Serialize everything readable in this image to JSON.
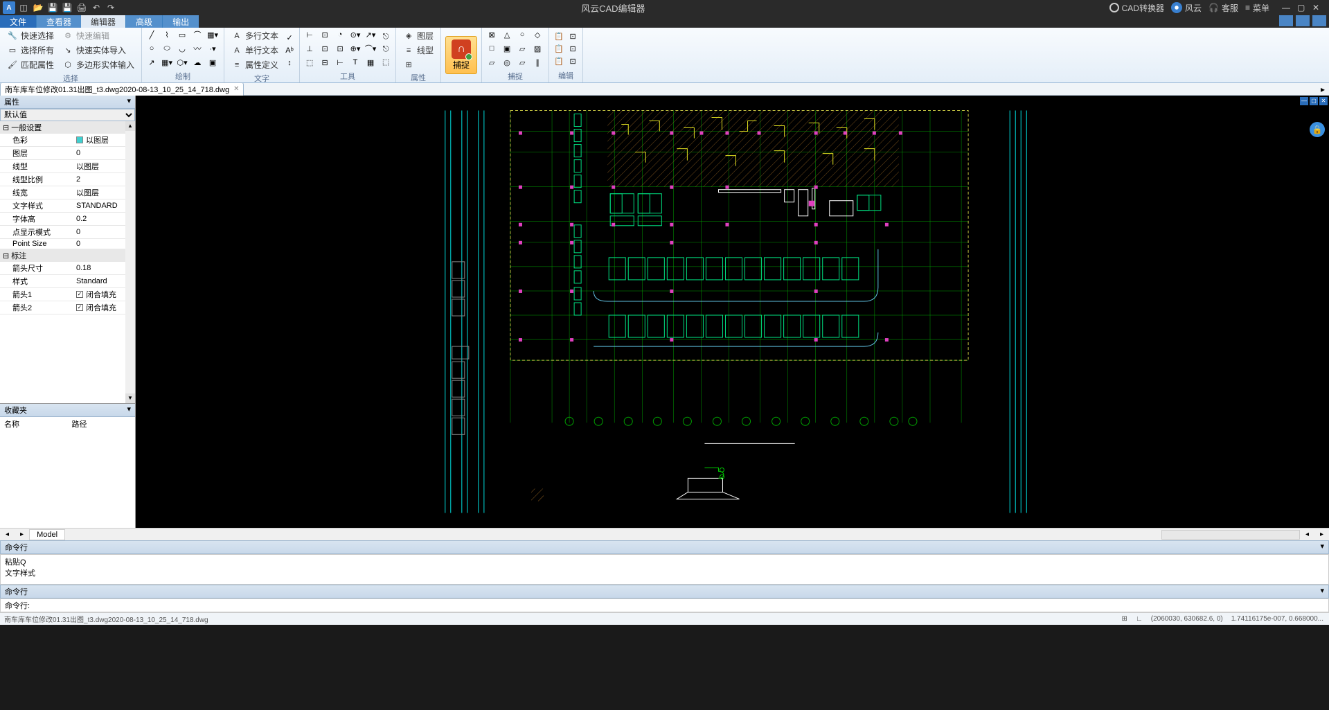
{
  "app_title": "风云CAD编辑器",
  "titlebar_right": {
    "converter": "CAD转换器",
    "fengyun": "风云",
    "support": "客服",
    "menu": "菜单"
  },
  "menubar": {
    "file": "文件",
    "view": "查看器",
    "edit": "编辑器",
    "advanced": "高级",
    "output": "输出"
  },
  "ribbon": {
    "select_group": "选择",
    "quick_select": "快速选择",
    "select_all": "选择所有",
    "match_props": "匹配属性",
    "quick_edit": "快速编辑",
    "quick_entity_import": "快速实体导入",
    "poly_entity_input": "多边形实体输入",
    "draw_group": "绘制",
    "text_group": "文字",
    "mtext": "多行文本",
    "stext": "单行文本",
    "attdef": "属性定义",
    "tool_group": "工具",
    "layer_prop": "属性",
    "layer": "图层",
    "linetype": "线型",
    "snap": "捕捉",
    "snap_group": "捕捉",
    "edit_group": "编辑"
  },
  "doc_tab": "南车库车位修改01.31出图_t3.dwg2020-08-13_10_25_14_718.dwg",
  "properties": {
    "header": "属性",
    "default_value": "默认值",
    "general": "一般设置",
    "color": "色彩",
    "color_val": "以图层",
    "layer": "图层",
    "layer_val": "0",
    "linetype": "线型",
    "linetype_val": "以图层",
    "linescale": "线型比例",
    "linescale_val": "2",
    "lineweight": "线宽",
    "lineweight_val": "以图层",
    "textstyle": "文字样式",
    "textstyle_val": "STANDARD",
    "textheight": "字体高",
    "textheight_val": "0.2",
    "pointmode": "点显示模式",
    "pointmode_val": "0",
    "pointsize": "Point Size",
    "pointsize_val": "0",
    "dimension": "标注",
    "arrowsize": "箭头尺寸",
    "arrowsize_val": "0.18",
    "style": "样式",
    "style_val": "Standard",
    "arrow1": "箭头1",
    "arrow1_val": "闭合填充",
    "arrow2": "箭头2",
    "arrow2_val": "闭合填充"
  },
  "favorites": {
    "header": "收藏夹",
    "name": "名称",
    "path": "路径"
  },
  "model_tab": "Model",
  "cmd": {
    "header": "命令行",
    "line1": "粘贴Q",
    "line2": "文字样式",
    "prompt": "命令行:"
  },
  "status": {
    "file": "南车库车位修改01.31出图_t3.dwg2020-08-13_10_25_14_718.dwg",
    "coords": "(2060030, 630682.6, 0)",
    "scale": "1.74116175e-007, 0.668000..."
  }
}
